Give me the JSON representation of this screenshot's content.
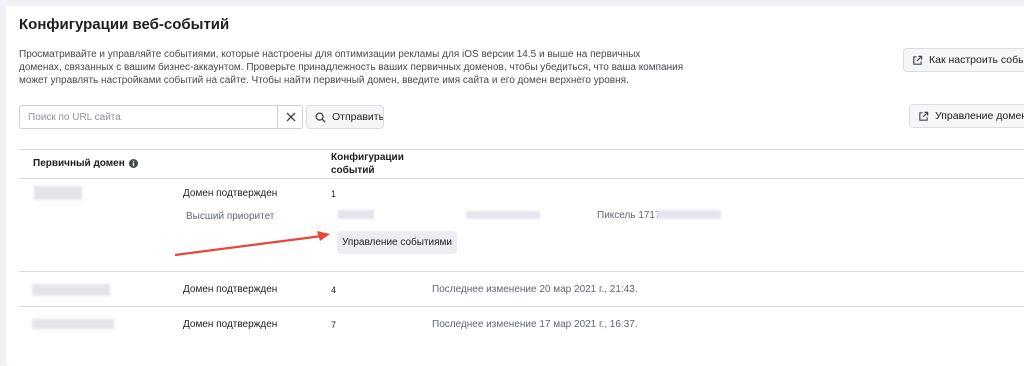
{
  "header": {
    "title": "Конфигурации веб-событий",
    "description": "Просматривайте и управляйте событиями, которые настроены для оптимизации рекламы для iOS версии 14.5 и выше на первичных доменах, связанных с вашим бизнес-аккаунтом. Проверьте принадлежность ваших первичных доменов, чтобы убедиться, что ваша компания может управлять настройками событий на сайте. Чтобы найти первичный домен, введите имя сайта и его домен верхнего уровня.",
    "setup_button": "Как настроить события",
    "manage_domains_button": "Управление доменами"
  },
  "search": {
    "placeholder": "Поиск по URL сайта",
    "value": "",
    "submit_label": "Отправить"
  },
  "table": {
    "col_domain": "Первичный домен",
    "col_configs": "Конфигурации событий",
    "rows": [
      {
        "status": "Домен подтвержден",
        "count": "1",
        "priority_label": "Высший приоритет",
        "pixel_label": "Пиксель 1717",
        "manage_button": "Управление событиями"
      },
      {
        "status": "Домен подтвержден",
        "count": "4",
        "last_change": "Последнее изменение 20 мар 2021 г., 21:43."
      },
      {
        "status": "Домен подтвержден",
        "count": "7",
        "last_change": "Последнее изменение 17 мар 2021 г., 16:37."
      }
    ]
  },
  "colors": {
    "annotation_arrow": "#e8453c",
    "background": "#f0f2f5",
    "panel": "#ffffff"
  }
}
